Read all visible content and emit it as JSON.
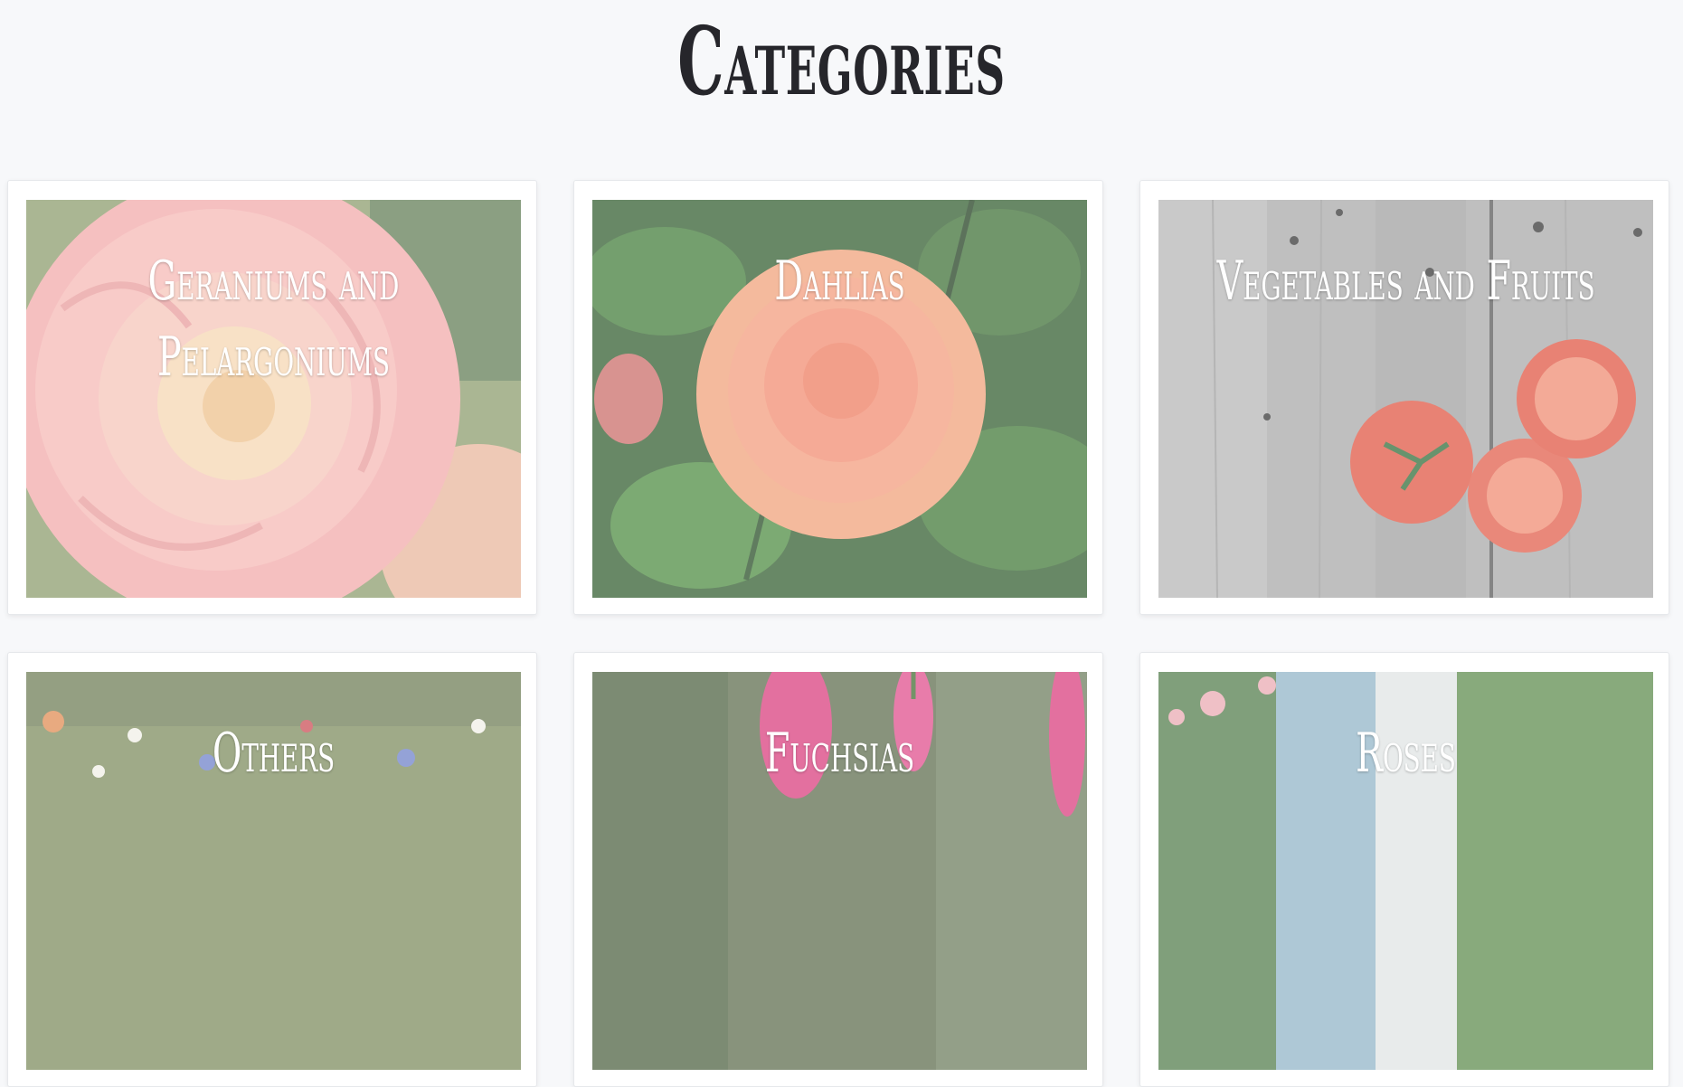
{
  "page": {
    "title": "Categories"
  },
  "categories": [
    {
      "label": "Geraniums and Pelargoniums",
      "image": "pink-begonia-flower"
    },
    {
      "label": "Dahlias",
      "image": "orange-dahlia-flower"
    },
    {
      "label": "Vegetables and Fruits",
      "image": "tomatoes-on-wood"
    },
    {
      "label": "Others",
      "image": "wildflower-meadow"
    },
    {
      "label": "Fuchsias",
      "image": "pink-fuchsia-flower"
    },
    {
      "label": "Roses",
      "image": "roses-by-doorway"
    }
  ],
  "colors": {
    "background": "#f7f8fa",
    "title": "#26262b",
    "card": "#ffffff",
    "label": "#ffffff"
  }
}
